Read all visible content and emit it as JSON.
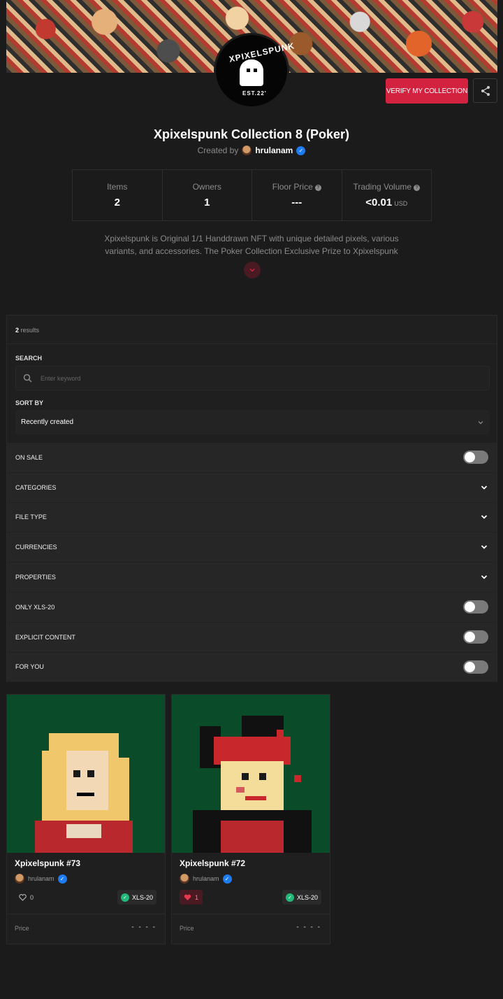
{
  "collection": {
    "title": "Xpixelspunk Collection 8 (Poker)",
    "created_by_label": "Created by",
    "creator": "hrulanam",
    "verify_button": "VERIFY MY COLLECTION",
    "logo_text_top": "XPIXELSPUNK",
    "logo_text_bottom": "EST.22'",
    "description": "Xpixelspunk is Original 1/1 Handdrawn NFT with unique detailed pixels, various variants, and accessories. The Poker Collection Exclusive Prize to Xpixelspunk"
  },
  "stats": [
    {
      "label": "Items",
      "value": "2"
    },
    {
      "label": "Owners",
      "value": "1"
    },
    {
      "label": "Floor Price",
      "value": "---"
    },
    {
      "label": "Trading Volume",
      "value": "<0.01",
      "unit": "USD"
    }
  ],
  "filters": {
    "results_count": "2",
    "results_label": "results",
    "search_label": "SEARCH",
    "search_placeholder": "Enter keyword",
    "sort_label": "SORT BY",
    "sort_value": "Recently created",
    "rows": [
      {
        "label": "ON SALE",
        "kind": "toggle",
        "on": false
      },
      {
        "label": "CATEGORIES",
        "kind": "expand"
      },
      {
        "label": "FILE TYPE",
        "kind": "expand"
      },
      {
        "label": "CURRENCIES",
        "kind": "expand"
      },
      {
        "label": "PROPERTIES",
        "kind": "expand"
      },
      {
        "label": "ONLY XLS-20",
        "kind": "toggle",
        "on": false
      },
      {
        "label": "EXPLICIT CONTENT",
        "kind": "toggle",
        "on": false
      },
      {
        "label": "FOR YOU",
        "kind": "toggle",
        "on": false
      }
    ]
  },
  "items": [
    {
      "name": "Xpixelspunk #73",
      "owner": "hrulanam",
      "likes": "0",
      "liked": false,
      "chain": "XLS-20",
      "price_label": "Price",
      "price": "- - - -"
    },
    {
      "name": "Xpixelspunk #72",
      "owner": "hrulanam",
      "likes": "1",
      "liked": true,
      "chain": "XLS-20",
      "price_label": "Price",
      "price": "- - - -"
    }
  ],
  "colors": {
    "accent": "#d3223f",
    "background": "#1b1b1c",
    "verified": "#1f7cf0",
    "chain": "#23b87a",
    "card_art_bg": "#0a4b2a"
  }
}
